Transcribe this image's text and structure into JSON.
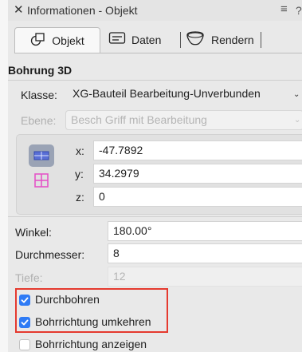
{
  "window": {
    "close_icon": "✕",
    "title": "Informationen - Objekt",
    "menu_icon": "≡",
    "help_icon": "?"
  },
  "tabs": [
    {
      "label": "Objekt",
      "icon": "shape-icon",
      "active": true
    },
    {
      "label": "Daten",
      "icon": "data-icon",
      "active": false
    },
    {
      "label": "Rendern",
      "icon": "render-icon",
      "active": false
    }
  ],
  "object": {
    "title": "Bohrung 3D",
    "klasse": {
      "label": "Klasse:",
      "value": "XG-Bauteil Bearbeitung-Unverbunden"
    },
    "ebene": {
      "label": "Ebene:",
      "value": "Besch Griff mit Bearbeitung",
      "disabled": true
    },
    "coords": {
      "x": {
        "label": "x:",
        "value": "-47.7892"
      },
      "y": {
        "label": "y:",
        "value": "34.2979"
      },
      "z": {
        "label": "z:",
        "value": "0"
      }
    },
    "winkel": {
      "label": "Winkel:",
      "value": "180.00°"
    },
    "durchmesser": {
      "label": "Durchmesser:",
      "value": "8"
    },
    "tiefe": {
      "label": "Tiefe:",
      "value": "12",
      "disabled": true
    }
  },
  "options": [
    {
      "label": "Durchbohren",
      "checked": true
    },
    {
      "label": "Bohrrichtung umkehren",
      "checked": true
    },
    {
      "label": "Bohrrichtung anzeigen",
      "checked": false
    }
  ],
  "colors": {
    "accent": "#2f7bf5",
    "highlight": "#e53a2f",
    "view_icon": "#4a63c9",
    "grid_icon": "#e455c8"
  }
}
